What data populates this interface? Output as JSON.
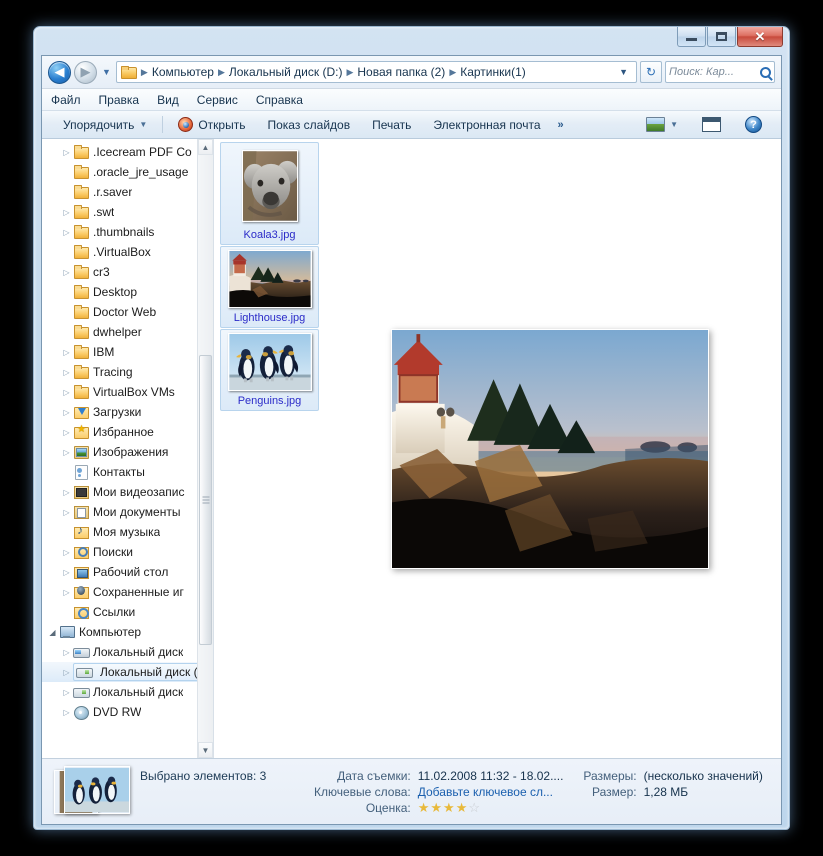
{
  "window": {
    "buttons": {
      "minimize": "–",
      "maximize": "❐",
      "close": "✕"
    }
  },
  "addressbar": {
    "back_icon": "back-arrow",
    "forward_icon": "forward-arrow",
    "history_icon": "chevron-down",
    "crumbs": [
      "Компьютер",
      "Локальный диск (D:)",
      "Новая папка (2)",
      "Картинки(1)"
    ],
    "separator": "▶",
    "dropdown": "▼",
    "refresh": "↻",
    "search_placeholder": "Поиск: Кар..."
  },
  "menubar": {
    "items": [
      "Файл",
      "Правка",
      "Вид",
      "Сервис",
      "Справка"
    ]
  },
  "toolbar": {
    "organize": "Упорядочить",
    "organize_caret": "▼",
    "open": "Открыть",
    "slideshow": "Показ слайдов",
    "print": "Печать",
    "email": "Электронная почта",
    "overflow": "»",
    "view_caret": "▼"
  },
  "navpane": {
    "items": [
      {
        "label": ".Icecream PDF Co",
        "icon": "folder-icon",
        "expander": "▷",
        "indent": 1
      },
      {
        "label": ".oracle_jre_usage",
        "icon": "folder-icon",
        "expander": "",
        "indent": 1
      },
      {
        "label": ".r.saver",
        "icon": "folder-icon",
        "expander": "",
        "indent": 1
      },
      {
        "label": ".swt",
        "icon": "folder-icon",
        "expander": "▷",
        "indent": 1
      },
      {
        "label": ".thumbnails",
        "icon": "folder-icon",
        "expander": "▷",
        "indent": 1
      },
      {
        "label": ".VirtualBox",
        "icon": "folder-icon",
        "expander": "",
        "indent": 1
      },
      {
        "label": "cr3",
        "icon": "folder-icon",
        "expander": "▷",
        "indent": 1
      },
      {
        "label": "Desktop",
        "icon": "folder-icon",
        "expander": "",
        "indent": 1
      },
      {
        "label": "Doctor Web",
        "icon": "folder-icon",
        "expander": "",
        "indent": 1
      },
      {
        "label": "dwhelper",
        "icon": "folder-icon",
        "expander": "",
        "indent": 1
      },
      {
        "label": "IBM",
        "icon": "folder-icon",
        "expander": "▷",
        "indent": 1
      },
      {
        "label": "Tracing",
        "icon": "folder-icon",
        "expander": "▷",
        "indent": 1
      },
      {
        "label": "VirtualBox VMs",
        "icon": "folder-icon",
        "expander": "▷",
        "indent": 1
      },
      {
        "label": "Загрузки",
        "icon": "downloads-folder-icon",
        "expander": "▷",
        "indent": 1
      },
      {
        "label": "Избранное",
        "icon": "favorites-folder-icon",
        "expander": "▷",
        "indent": 1
      },
      {
        "label": "Изображения",
        "icon": "pictures-folder-icon",
        "expander": "▷",
        "indent": 1
      },
      {
        "label": "Контакты",
        "icon": "contacts-folder-icon",
        "expander": "",
        "indent": 1
      },
      {
        "label": "Мои видеозапис",
        "icon": "videos-folder-icon",
        "expander": "▷",
        "indent": 1
      },
      {
        "label": "Мои документы",
        "icon": "documents-folder-icon",
        "expander": "▷",
        "indent": 1
      },
      {
        "label": "Моя музыка",
        "icon": "music-folder-icon",
        "expander": "",
        "indent": 1
      },
      {
        "label": "Поиски",
        "icon": "searches-folder-icon",
        "expander": "▷",
        "indent": 1
      },
      {
        "label": "Рабочий стол",
        "icon": "desktop-folder-icon",
        "expander": "▷",
        "indent": 1
      },
      {
        "label": "Сохраненные иг",
        "icon": "saved-games-folder-icon",
        "expander": "▷",
        "indent": 1
      },
      {
        "label": "Ссылки",
        "icon": "links-folder-icon",
        "expander": "",
        "indent": 1
      },
      {
        "label": "Компьютер",
        "icon": "computer-icon",
        "expander": "◢",
        "indent": 0
      },
      {
        "label": "Локальный диск",
        "icon": "system-drive-icon",
        "expander": "▷",
        "indent": 1
      },
      {
        "label": "Локальный диск (D:)",
        "icon": "drive-icon",
        "expander": "▷",
        "indent": 1,
        "selected": true
      },
      {
        "label": "Локальный диск",
        "icon": "drive-icon",
        "expander": "▷",
        "indent": 1
      },
      {
        "label": "DVD RW",
        "icon": "dvd-drive-icon",
        "expander": "▷",
        "indent": 1
      }
    ],
    "scrollbar": {
      "up": "▲",
      "down": "▼"
    }
  },
  "filelist": {
    "files": [
      {
        "name": "Koala3.jpg",
        "selected": true
      },
      {
        "name": "Lighthouse.jpg",
        "selected": true
      },
      {
        "name": "Penguins.jpg",
        "selected": true
      }
    ],
    "annotation_color": "#ee1111"
  },
  "preview": {
    "file": "Lighthouse.jpg"
  },
  "details": {
    "selection": "Выбрано элементов: 3",
    "fields": [
      {
        "key": "Дата съемки:",
        "value": "11.02.2008 11:32 - 18.02...."
      },
      {
        "key": "Ключевые слова:",
        "value": "Добавьте ключевое сл...",
        "link": true
      },
      {
        "key": "Оценка:",
        "value": ""
      }
    ],
    "right_fields": [
      {
        "key": "Размеры:",
        "value": "(несколько значений)"
      },
      {
        "key": "Размер:",
        "value": "1,28 МБ"
      }
    ],
    "rating": {
      "filled": 4,
      "total": 5,
      "glyph_on": "★",
      "glyph_off": "☆"
    }
  }
}
